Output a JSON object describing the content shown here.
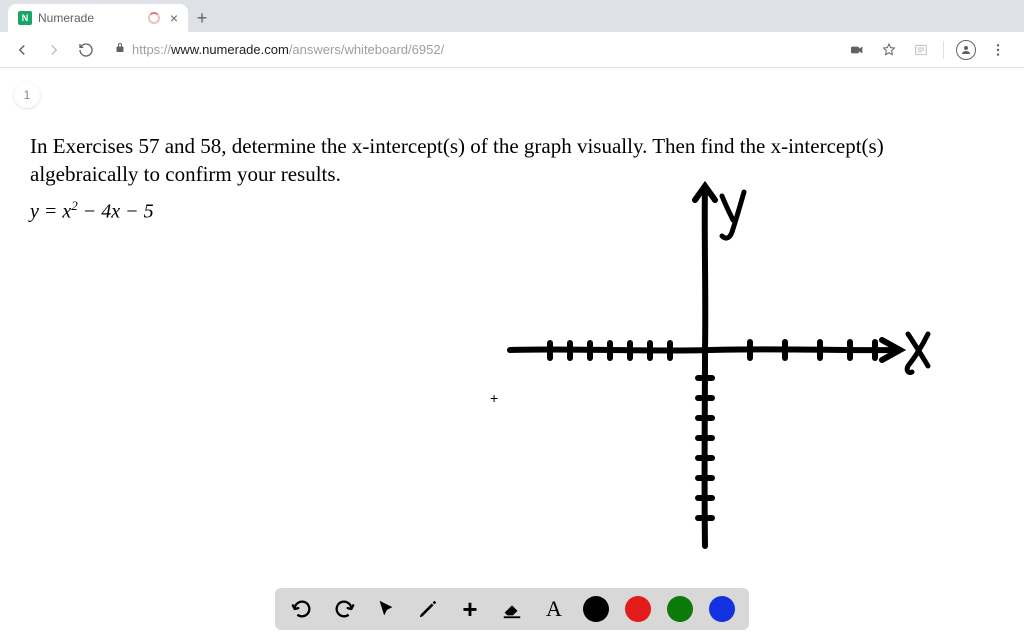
{
  "browser": {
    "tab_title": "Numerade",
    "close_glyph": "×",
    "new_tab_glyph": "+",
    "url_scheme": "https://",
    "url_host": "www.numerade.com",
    "url_path": "/answers/whiteboard/6952/"
  },
  "page": {
    "badge": "1",
    "question_text": "In Exercises 57 and 58, determine the x-intercept(s) of the graph visually. Then find the x-intercept(s) algebraically to confirm your results.",
    "equation_lhs": "y = x",
    "equation_exp": "2",
    "equation_rhs": " − 4x − 5",
    "axis_y_label": "y",
    "axis_x_label": "x",
    "crosshair": "+"
  },
  "toolbar": {
    "colors": {
      "black": "#000000",
      "red": "#e31b1b",
      "green": "#0b7a0b",
      "blue": "#1232e0"
    },
    "text_tool_label": "A",
    "move_tool_label": "+"
  }
}
